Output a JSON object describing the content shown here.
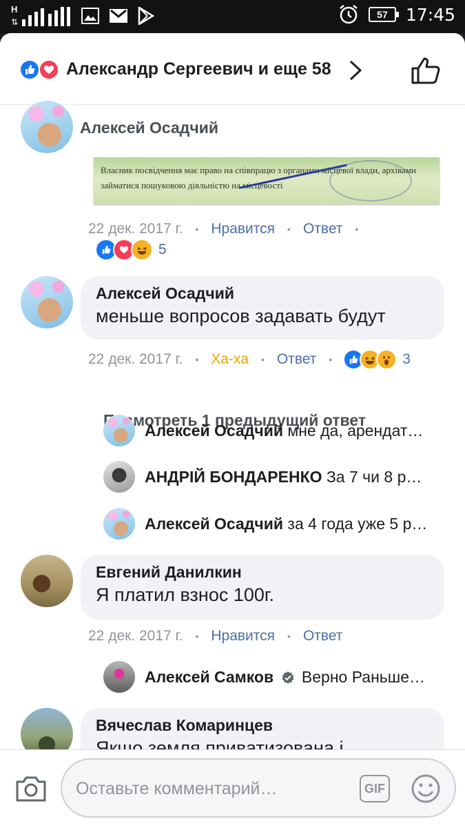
{
  "status_bar": {
    "time": "17:45",
    "battery": "57",
    "network_letter": "H",
    "icons": [
      "signal-icon",
      "gallery-icon",
      "gmail-icon",
      "play-store-icon",
      "alarm-icon",
      "battery-icon"
    ]
  },
  "header": {
    "title": "Александр Сергеевич и еще 58",
    "reactions": [
      "like-icon",
      "love-icon"
    ],
    "actions": [
      "chevron-right-icon",
      "thumbs-up-icon"
    ]
  },
  "comments": [
    {
      "name": "Алексей Осадчий",
      "attachment": {
        "line1": "Власник посвідчення має право на співпрацю з органами місцевої влади, архівами",
        "line2": "займатися пошуковою діяльністю на місцевості"
      },
      "date": "22 дек. 2017 г.",
      "like": "Нравится",
      "reply": "Ответ",
      "reactions_count": "5"
    },
    {
      "name": "Алексей Осадчий",
      "text": "меньше вопросов задавать будут",
      "date": "22 дек. 2017 г.",
      "like": "Ха-ха",
      "reply": "Ответ",
      "reactions_count": "3",
      "view_previous": "Посмотреть 1 предыдущий ответ",
      "replies": [
        {
          "name": "Алексей Осадчий",
          "text": "мне да, арендат…"
        },
        {
          "name": "АНДРІЙ БОНДАРЕНКО",
          "text": "За 7 чи 8 р…"
        },
        {
          "name": "Алексей Осадчий",
          "text": "за 4 года уже 5 р…"
        }
      ]
    },
    {
      "name": "Евгений Данилкин",
      "text": "Я платил взнос 100г.",
      "date": "22 дек. 2017 г.",
      "like": "Нравится",
      "reply": "Ответ",
      "replies": [
        {
          "name": "Алексей Самков",
          "text": "Верно Раньше…"
        }
      ]
    },
    {
      "name": "Вячеслав Комаринцев",
      "text": "Якщо земля приватизована і"
    }
  ],
  "composer": {
    "placeholder": "Оставьте комментарий…",
    "gif_label": "GIF"
  },
  "colors": {
    "like": "#1877f2",
    "love": "#f33e58",
    "haha": "#f7b125",
    "link": "#4b6fa8",
    "meta": "#90949c",
    "bubble": "#f0f2f5"
  }
}
